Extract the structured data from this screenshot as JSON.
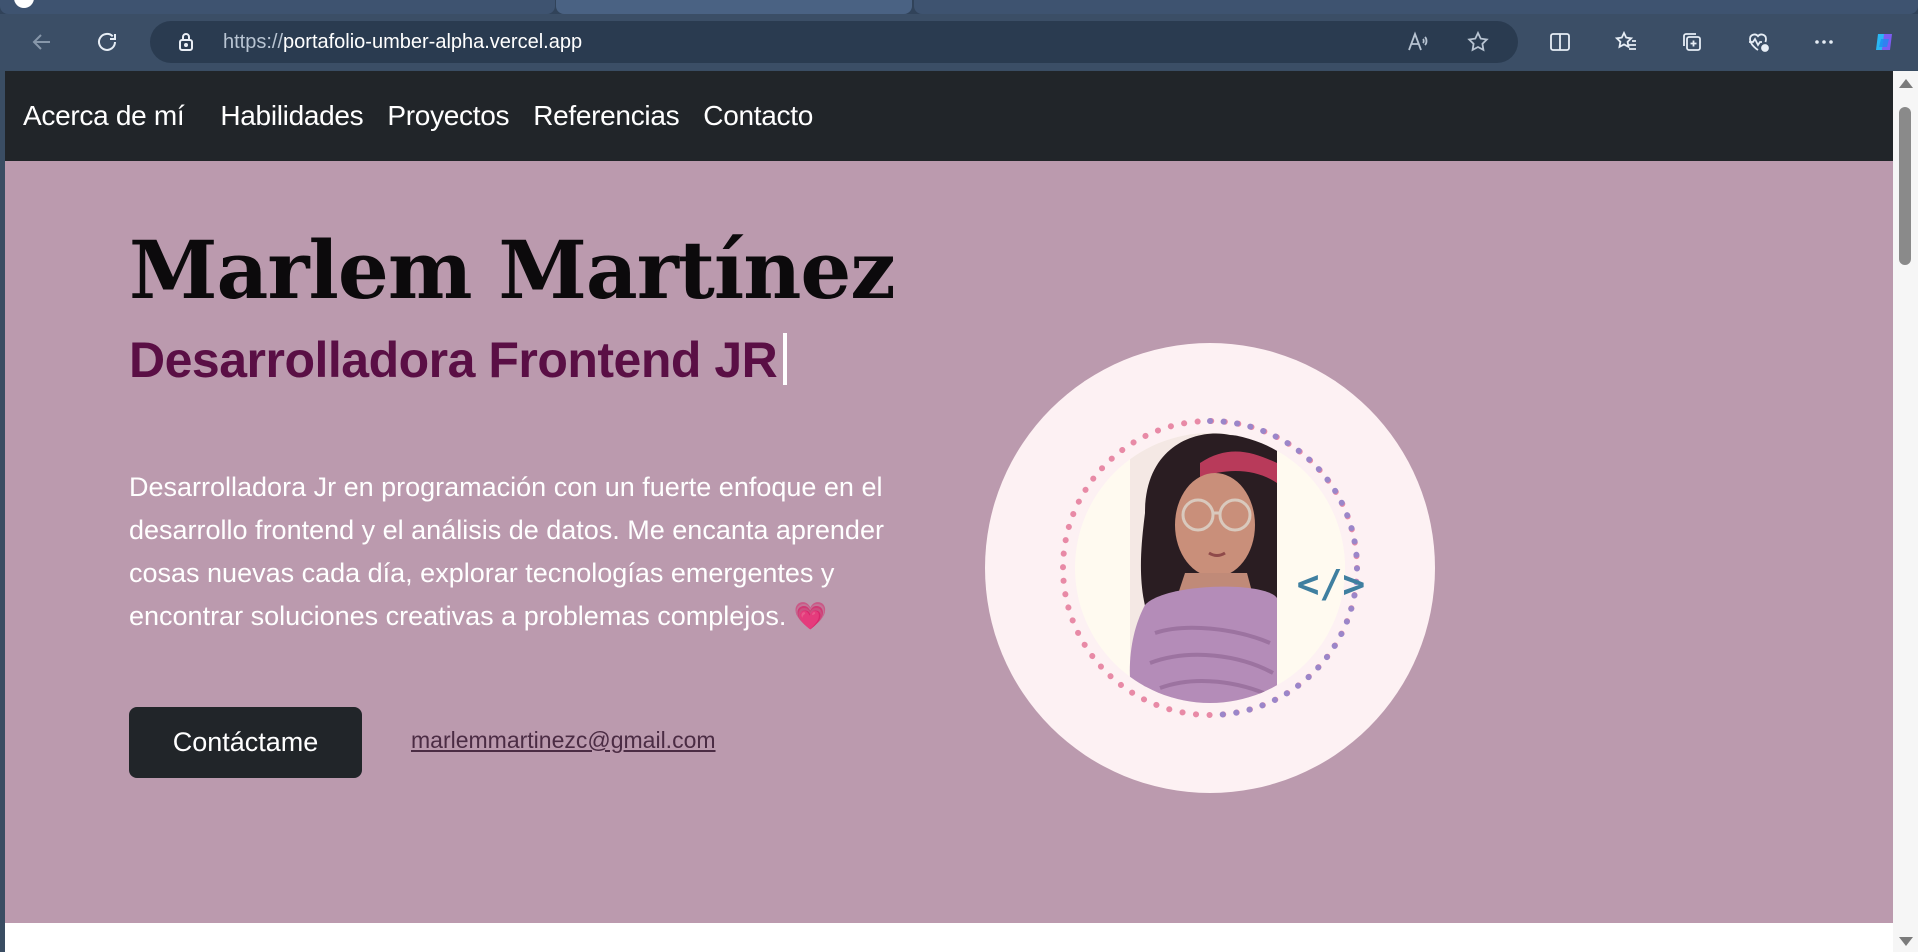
{
  "browser": {
    "url_protocol": "https://",
    "url_host": "portafolio-umber-alpha.vercel.app"
  },
  "icons": {
    "back": "back-arrow-icon",
    "refresh": "refresh-icon",
    "lock": "lock-icon",
    "read_aloud": "read-aloud-icon",
    "favorite": "star-icon",
    "split": "split-screen-icon",
    "favorites": "favorites-icon",
    "collections": "collections-icon",
    "health": "browser-essentials-icon",
    "more": "more-icon",
    "copilot": "copilot-icon"
  },
  "nav": {
    "items": [
      "Acerca de mí",
      "Habilidades",
      "Proyectos",
      "Referencias",
      "Contacto"
    ]
  },
  "hero": {
    "name": "Marlem Martínez",
    "role": "Desarrolladora Frontend JR",
    "description": "Desarrolladora Jr en programación con un fuerte enfoque en el desarrollo frontend y el análisis de datos. Me encanta aprender cosas nuevas cada día, explorar tecnologías emergentes y encontrar soluciones creativas a problemas complejos.",
    "heart": "💗",
    "cta_label": "Contáctame",
    "email": "marlemmartinezc@gmail.com",
    "avatar_badge": "</>"
  },
  "colors": {
    "navbar_bg": "#212529",
    "hero_bg": "#bb9aae",
    "role_color": "#5a0f45",
    "avatar_bg": "#fdf1f3"
  }
}
